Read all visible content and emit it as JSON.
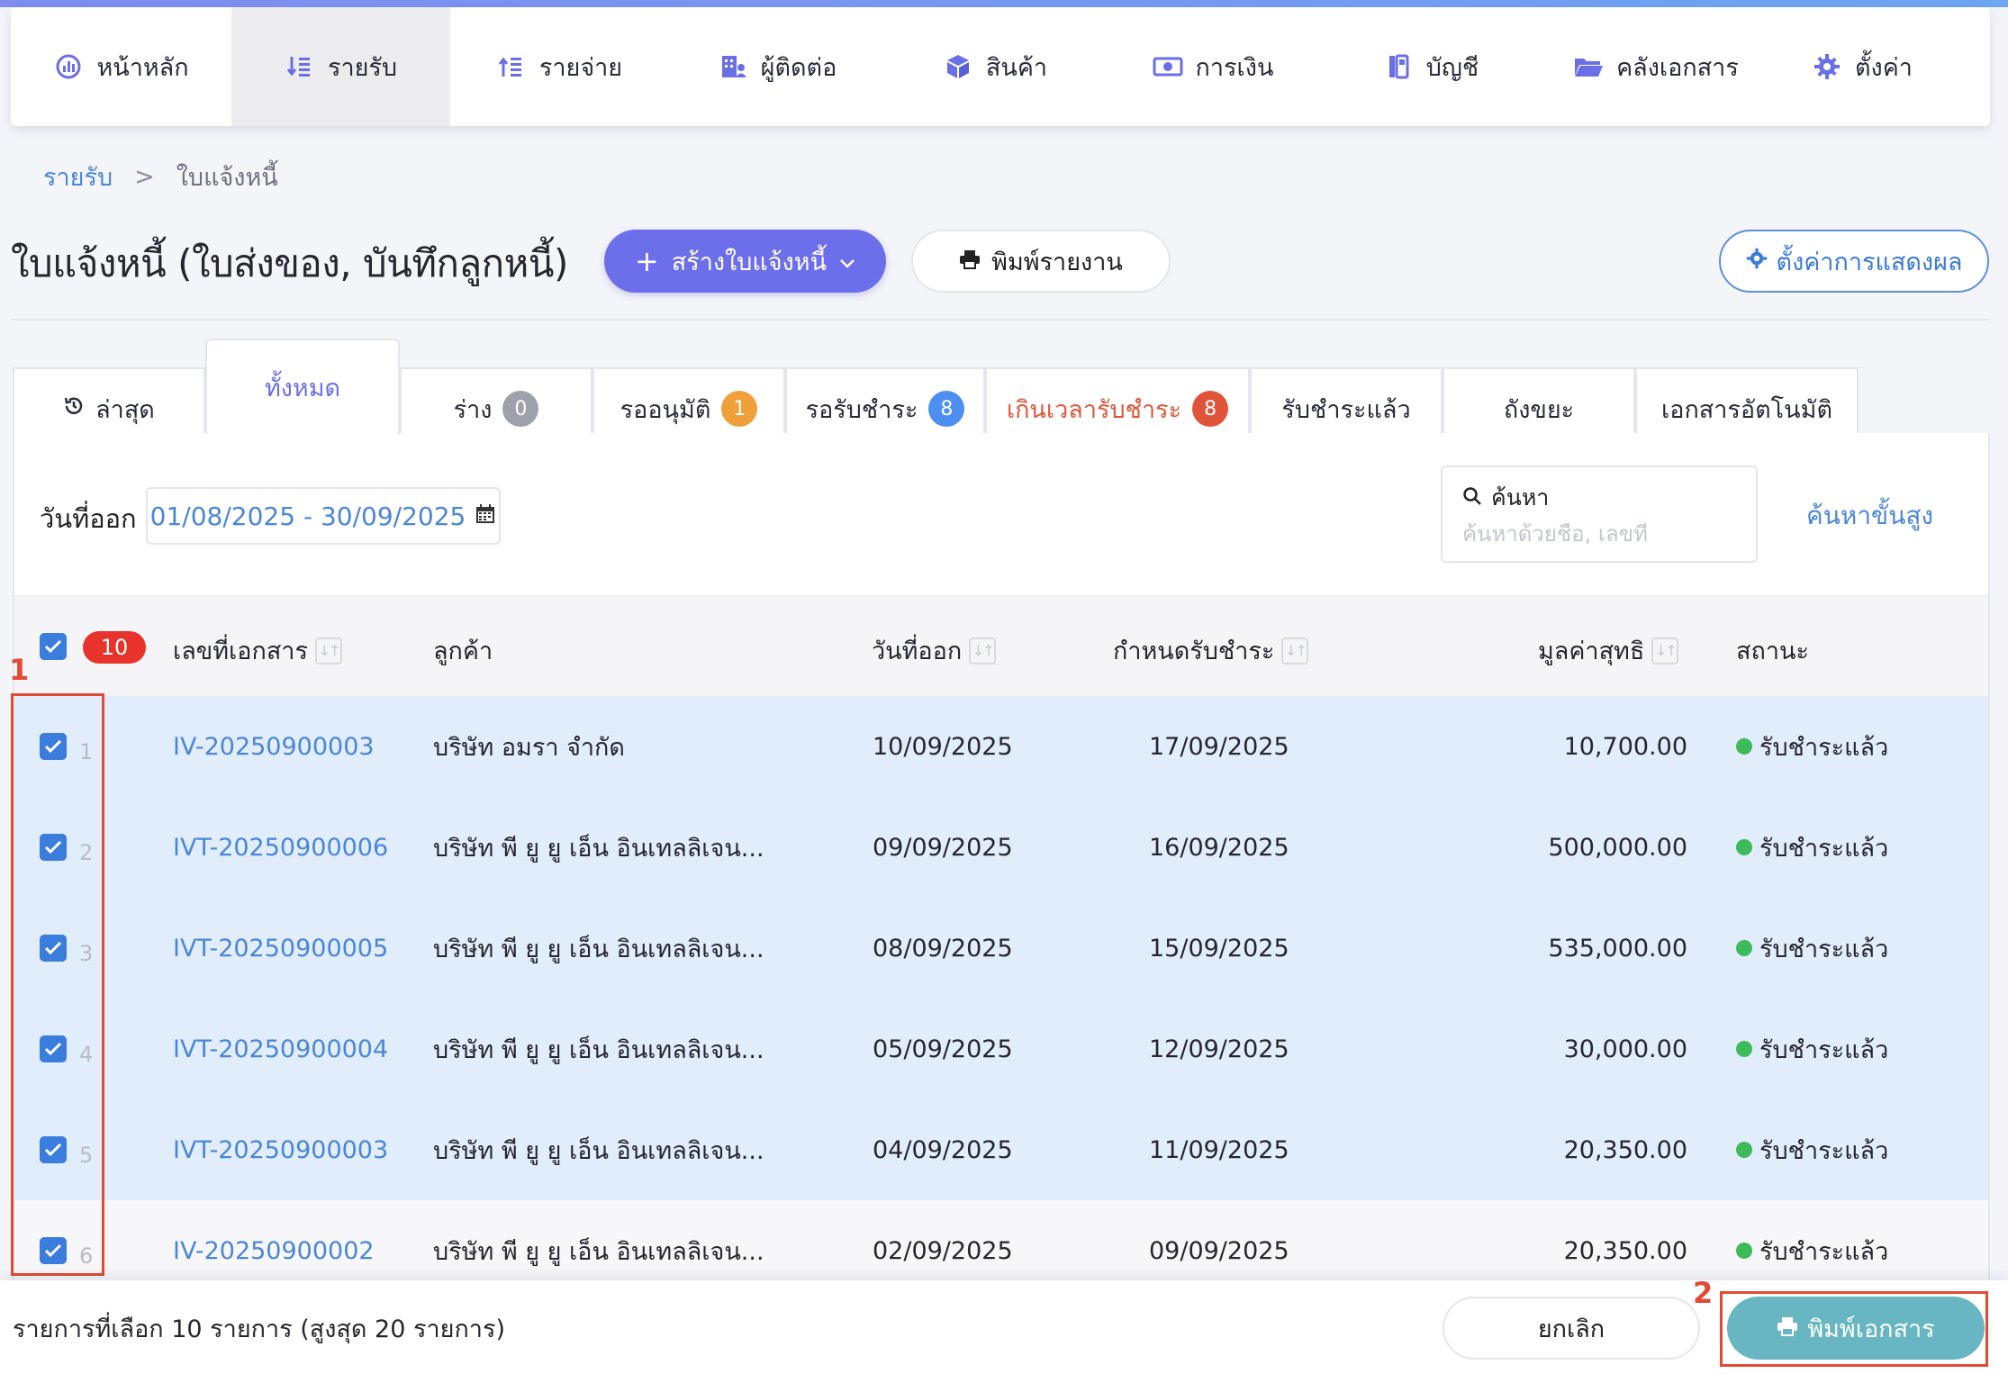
{
  "nav": {
    "items": [
      {
        "label": "หน้าหลัก",
        "icon": "dashboard-icon"
      },
      {
        "label": "รายรับ",
        "icon": "income-icon",
        "active": true
      },
      {
        "label": "รายจ่าย",
        "icon": "expense-icon"
      },
      {
        "label": "ผู้ติดต่อ",
        "icon": "contacts-icon"
      },
      {
        "label": "สินค้า",
        "icon": "box-icon"
      },
      {
        "label": "การเงิน",
        "icon": "money-icon"
      },
      {
        "label": "บัญชี",
        "icon": "book-icon"
      },
      {
        "label": "คลังเอกสาร",
        "icon": "folder-icon"
      },
      {
        "label": "ตั้งค่า",
        "icon": "gear-icon"
      }
    ]
  },
  "breadcrumb": {
    "parent": "รายรับ",
    "separator": ">",
    "current": "ใบแจ้งหนี้"
  },
  "page": {
    "title": "ใบแจ้งหนี้ (ใบส่งของ, บันทึกลูกหนี้)",
    "create_label": "สร้างใบแจ้งหนี้",
    "report_label": "พิมพ์รายงาน",
    "display_settings_label": "ตั้งค่าการแสดงผล"
  },
  "tabs": [
    {
      "label": "ล่าสุด",
      "icon": "history-icon"
    },
    {
      "label": "ทั้งหมด",
      "active": true
    },
    {
      "label": "ร่าง",
      "badge": "0",
      "badge_color": "#9ea1ab"
    },
    {
      "label": "รออนุมัติ",
      "badge": "1",
      "badge_color": "#f0a03a"
    },
    {
      "label": "รอรับชำระ",
      "badge": "8",
      "badge_color": "#4c8ff0"
    },
    {
      "label": "เกินเวลารับชำระ",
      "badge": "8",
      "badge_color": "#e0553a",
      "danger": true
    },
    {
      "label": "รับชำระแล้ว"
    },
    {
      "label": "ถังขยะ"
    },
    {
      "label": "เอกสารอัตโนมัติ"
    }
  ],
  "filters": {
    "date_label": "วันที่ออก",
    "date_range": "01/08/2025 - 30/09/2025",
    "search_title": "ค้นหา",
    "search_placeholder": "ค้นหาด้วยชื่อ, เลขที่",
    "advanced_label": "ค้นหาขั้นสูง"
  },
  "table": {
    "selected_count": "10",
    "headers": {
      "doc_no": "เลขที่เอกสาร",
      "customer": "ลูกค้า",
      "issue_date": "วันที่ออก",
      "due_date": "กำหนดรับชำระ",
      "net_value": "มูลค่าสุทธิ",
      "status": "สถานะ"
    },
    "rows": [
      {
        "num": "1",
        "doc_no": "IV-20250900003",
        "customer": "บริษัท อมรา จำกัด",
        "issue_date": "10/09/2025",
        "due_date": "17/09/2025",
        "net_value": "10,700.00",
        "status": "รับชำระแล้ว"
      },
      {
        "num": "2",
        "doc_no": "IVT-20250900006",
        "customer": "บริษัท พี ยู ยู เอ็น อินเทลลิเจน...",
        "issue_date": "09/09/2025",
        "due_date": "16/09/2025",
        "net_value": "500,000.00",
        "status": "รับชำระแล้ว"
      },
      {
        "num": "3",
        "doc_no": "IVT-20250900005",
        "customer": "บริษัท พี ยู ยู เอ็น อินเทลลิเจน...",
        "issue_date": "08/09/2025",
        "due_date": "15/09/2025",
        "net_value": "535,000.00",
        "status": "รับชำระแล้ว"
      },
      {
        "num": "4",
        "doc_no": "IVT-20250900004",
        "customer": "บริษัท พี ยู ยู เอ็น อินเทลลิเจน...",
        "issue_date": "05/09/2025",
        "due_date": "12/09/2025",
        "net_value": "30,000.00",
        "status": "รับชำระแล้ว"
      },
      {
        "num": "5",
        "doc_no": "IVT-20250900003",
        "customer": "บริษัท พี ยู ยู เอ็น อินเทลลิเจน...",
        "issue_date": "04/09/2025",
        "due_date": "11/09/2025",
        "net_value": "20,350.00",
        "status": "รับชำระแล้ว"
      },
      {
        "num": "6",
        "doc_no": "IV-20250900002",
        "customer": "บริษัท พี ยู ยู เอ็น อินเทลลิเจน...",
        "issue_date": "02/09/2025",
        "due_date": "09/09/2025",
        "net_value": "20,350.00",
        "status": "รับชำระแล้ว"
      }
    ]
  },
  "bottom_bar": {
    "selection_text": "รายการที่เลือก 10 รายการ (สูงสุด 20 รายการ)",
    "cancel_label": "ยกเลิก",
    "print_label": "พิมพ์เอกสาร"
  },
  "annotations": {
    "step1": "1",
    "step2": "2"
  },
  "colors": {
    "accent": "#6d6ee9",
    "link": "#4a86d8",
    "selected_row": "#e2edfb",
    "print_button": "#67b6c2",
    "annotation": "#e34a35"
  }
}
